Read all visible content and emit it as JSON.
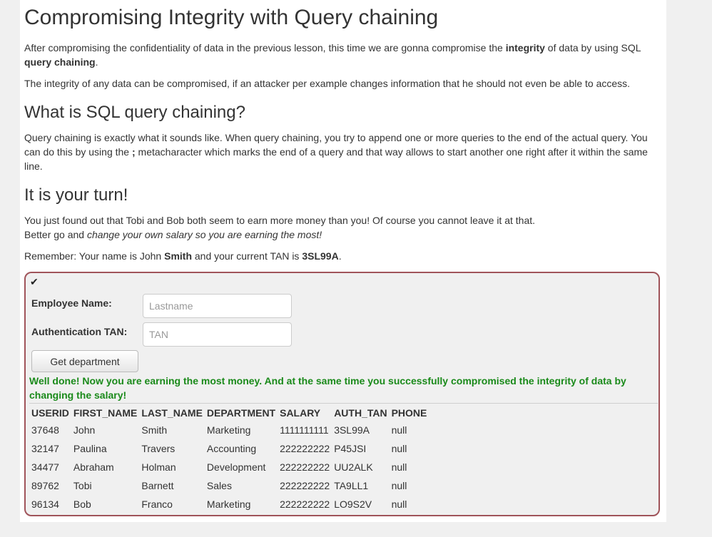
{
  "lesson": {
    "title": "Compromising Integrity with Query chaining",
    "intro": {
      "t1": "After compromising the confidentiality of data in the previous lesson, this time we are gonna compromise the ",
      "b1": "integrity",
      "t2": " of data by using SQL ",
      "b2": "query chaining",
      "t3": "."
    },
    "integrity_text": "The integrity of any data can be compromised, if an attacker per example changes information that he should not even be able to access.",
    "section1_title": "What is SQL query chaining?",
    "chaining": {
      "t1": "Query chaining is exactly what it sounds like. When query chaining, you try to append one or more queries to the end of the actual query. You can do this by using the ",
      "b1": ";",
      "t2": " metacharacter which marks the end of a query and that way allows to start another one right after it within the same line."
    },
    "section2_title": "It is your turn!",
    "turn": {
      "line1": "You just found out that Tobi and Bob both seem to earn more money than you! Of course you cannot leave it at that.",
      "t2": "Better go and ",
      "i2": "change your own salary so you are earning the most!"
    },
    "remember": {
      "t1": "Remember: Your name is John ",
      "b1": "Smith",
      "t2": " and your current TAN is ",
      "b2": "3SL99A",
      "t3": "."
    }
  },
  "form": {
    "check_icon": "checkmark-icon",
    "name_label": "Employee Name:",
    "name_placeholder": "Lastname",
    "tan_label": "Authentication TAN:",
    "tan_placeholder": "TAN",
    "submit_label": "Get department",
    "feedback": "Well done! Now you are earning the most money. And at the same time you successfully compromised the integrity of data by changing the salary!"
  },
  "results": {
    "columns": [
      "USERID",
      "FIRST_NAME",
      "LAST_NAME",
      "DEPARTMENT",
      "SALARY",
      "AUTH_TAN",
      "PHONE"
    ],
    "rows": [
      [
        "37648",
        "John",
        "Smith",
        "Marketing",
        "1111111111",
        "3SL99A",
        "null"
      ],
      [
        "32147",
        "Paulina",
        "Travers",
        "Accounting",
        "222222222",
        "P45JSI",
        "null"
      ],
      [
        "34477",
        "Abraham",
        "Holman",
        "Development",
        "222222222",
        "UU2ALK",
        "null"
      ],
      [
        "89762",
        "Tobi",
        "Barnett",
        "Sales",
        "222222222",
        "TA9LL1",
        "null"
      ],
      [
        "96134",
        "Bob",
        "Franco",
        "Marketing",
        "222222222",
        "LO9S2V",
        "null"
      ]
    ]
  },
  "colors": {
    "success": "#1a8a1a",
    "attack_border": "#a0545a"
  }
}
